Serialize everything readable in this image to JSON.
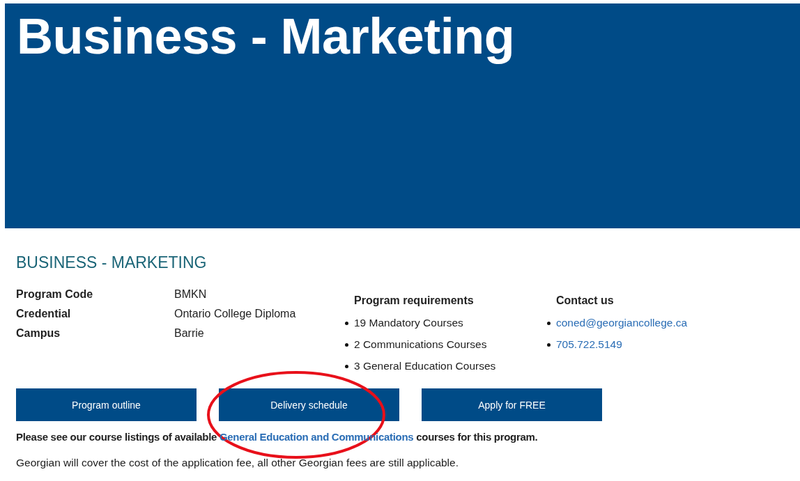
{
  "banner": {
    "title": "Business - Marketing"
  },
  "program": {
    "heading": "BUSINESS - MARKETING",
    "details": [
      {
        "label": "Program Code",
        "value": "BMKN"
      },
      {
        "label": "Credential",
        "value": "Ontario College Diploma"
      },
      {
        "label": "Campus",
        "value": "Barrie"
      }
    ],
    "requirements": {
      "title": "Program requirements",
      "items": [
        "19 Mandatory Courses",
        "2 Communications Courses",
        "3 General Education Courses"
      ]
    },
    "contact": {
      "title": "Contact us",
      "items": [
        "coned@georgiancollege.ca",
        "705.722.5149"
      ]
    }
  },
  "buttons": [
    "Program outline",
    "Delivery schedule",
    "Apply for FREE"
  ],
  "notice": {
    "before": "Please see our course listings of available ",
    "link": "General Education and Communications",
    "after": " courses for this program."
  },
  "fee_note": "Georgian will cover the cost of the application fee, all other Georgian fees are still applicable.",
  "annotation": {
    "kind": "circle"
  }
}
